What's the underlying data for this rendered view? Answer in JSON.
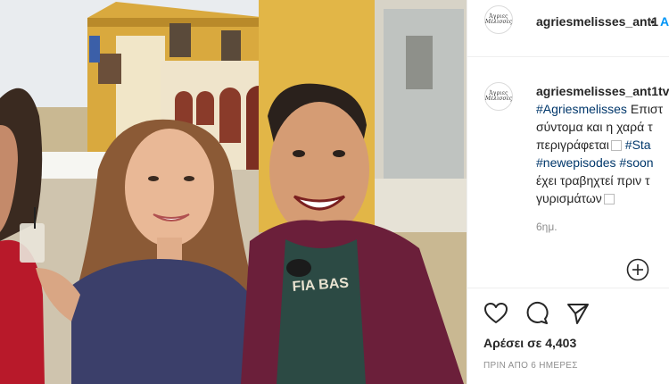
{
  "post": {
    "username": "agriesmelisses_ant1",
    "separator": "•",
    "follow_label": "A",
    "avatar_line1": "Άγριες",
    "avatar_line2": "Μέλισσες"
  },
  "caption": {
    "username": "agriesmelisses_ant1tv",
    "line1_tag": "#Agriesmelisses",
    "line1_text": " Επιστ",
    "line2": "σύντομα και η χαρά τ",
    "line3_text": "περιγράφεται",
    "line3_tag": " #Sta",
    "line4_tag_a": "#newepisodes",
    "line4_tag_b": " #soon",
    "line5": "έχει τραβηχτεί πριν τ",
    "line6": "γυρισμάτων",
    "time": "6ημ."
  },
  "actions": {
    "like_icon": "heart-icon",
    "comment_icon": "comment-icon",
    "share_icon": "share-icon",
    "add_icon": "plus-circle-icon",
    "likes_text": "Αρέσει σε 4,403",
    "posted_ago": "ΠΡΙΝ ΑΠΟ 6 ΗΜΕΡΕΣ"
  },
  "photo": {
    "shirt_text": "FIA BAS"
  },
  "colors": {
    "link": "#00376b",
    "follow": "#0095f6",
    "muted": "#8e8e8e",
    "wall_yellow": "#e2b647"
  }
}
